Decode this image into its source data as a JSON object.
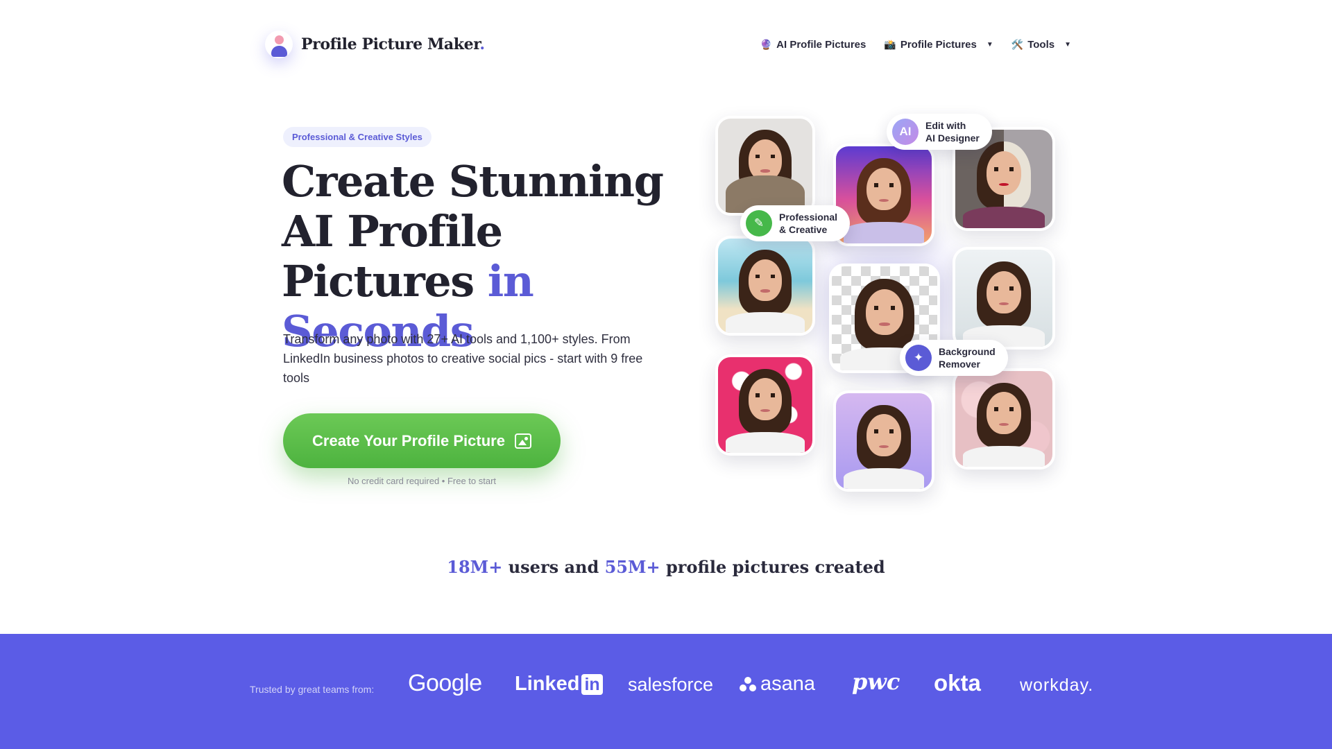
{
  "header": {
    "logo_text": "Profile Picture Maker",
    "logo_dot": ".",
    "nav": [
      {
        "icon": "crystal-ball-icon",
        "emoji": "🔮",
        "label": "AI Profile Pictures",
        "has_caret": false
      },
      {
        "icon": "camera-icon",
        "emoji": "📸",
        "label": "Profile Pictures",
        "has_caret": true
      },
      {
        "icon": "tools-icon",
        "emoji": "🛠️",
        "label": "Tools",
        "has_caret": true
      }
    ],
    "caret": "▼"
  },
  "hero": {
    "badge": "Professional & Creative Styles",
    "headline_main": "Create Stunning AI Profile Pictures ",
    "headline_accent": "in Seconds",
    "subtext": "Transform any photo with 27+ AI tools and 1,100+ styles. From LinkedIn business photos to creative social pics - start with 9 free tools",
    "cta_label": "Create Your Profile Picture",
    "cta_note": "No credit card required • Free to start"
  },
  "collage": {
    "tags": [
      {
        "icon": "ai-icon",
        "icon_text": "AI",
        "line1": "Edit with",
        "line2": "AI Designer"
      },
      {
        "icon": "brush-icon",
        "icon_text": "✎",
        "line1": "Professional",
        "line2": "& Creative"
      },
      {
        "icon": "magic-wand-icon",
        "icon_text": "✦",
        "line1": "Background",
        "line2": "Remover"
      }
    ]
  },
  "stats": {
    "users_num": "18M+",
    "users_text": " users and ",
    "pics_num": "55M+",
    "pics_text": " profile pictures created"
  },
  "trusted": {
    "label": "Trusted by great teams from:",
    "brands": {
      "google": "Google",
      "linkedin": "Linked",
      "linkedin_in": "in",
      "salesforce": "salesforce",
      "asana": "asana",
      "pwc": "pwc",
      "okta": "okta",
      "workday": "workday."
    }
  },
  "colors": {
    "accent": "#5b5bd6",
    "cta_green": "#56b947",
    "band": "#5b5ce6"
  }
}
